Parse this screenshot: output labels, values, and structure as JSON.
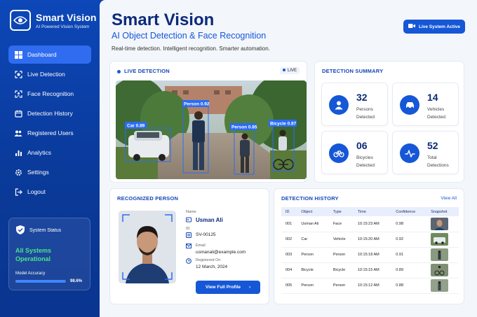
{
  "brand": {
    "name": "Smart Vision",
    "tagline": "AI Powered Vision System"
  },
  "nav": [
    {
      "label": "Dashboard",
      "icon": "dashboard-icon",
      "active": true
    },
    {
      "label": "Live Detection",
      "icon": "camera-scan-icon"
    },
    {
      "label": "Face Recognition",
      "icon": "face-scan-icon"
    },
    {
      "label": "Detection History",
      "icon": "calendar-icon"
    },
    {
      "label": "Registered Users",
      "icon": "users-icon"
    },
    {
      "label": "Analytics",
      "icon": "bar-chart-icon"
    },
    {
      "label": "Settings",
      "icon": "gear-icon"
    },
    {
      "label": "Logout",
      "icon": "logout-icon"
    }
  ],
  "system_status": {
    "title": "System Status",
    "status": "All Systems Operational",
    "accuracy_label": "Model Accuracy",
    "accuracy_value": "98.6%",
    "accuracy_fraction": 0.986
  },
  "header": {
    "title": "Smart Vision",
    "subtitle": "AI Object Detection & Face Recognition",
    "tagline": "Real-time detection. Intelligent recognition. Smarter automation.",
    "live_button": "Live System Active"
  },
  "live": {
    "title": "LIVE DETECTION",
    "badge": "LIVE",
    "boxes": [
      {
        "label": "Car 0.89"
      },
      {
        "label": "Person 0.92"
      },
      {
        "label": "Person 0.85"
      },
      {
        "label": "Bicycle 0.87"
      }
    ]
  },
  "summary": {
    "title": "DETECTION SUMMARY",
    "stats": [
      {
        "value": "32",
        "label": "Persons Detected",
        "icon": "person-icon"
      },
      {
        "value": "14",
        "label": "Vehicles Detected",
        "icon": "car-icon"
      },
      {
        "value": "06",
        "label": "Bicycles Detected",
        "icon": "bicycle-icon"
      },
      {
        "value": "52",
        "label": "Total Detections",
        "icon": "pulse-icon"
      }
    ]
  },
  "person": {
    "title": "RECOGNIZED PERSON",
    "name_label": "Name",
    "name": "Usman Ali",
    "id_label": "ID",
    "id": "SV-00125",
    "email_label": "Email",
    "email": "usmanali@example.com",
    "registered_label": "Registered On",
    "registered": "12 March, 2024",
    "button": "View Full Profile"
  },
  "history": {
    "title": "DETECTION HISTORY",
    "view_all": "View All",
    "columns": [
      "ID",
      "Object",
      "Type",
      "Time",
      "Confidence",
      "Snapshot"
    ],
    "rows": [
      {
        "id": "001",
        "object": "Usman Ali",
        "type": "Face",
        "time": "10:15:23 AM",
        "confidence": "0.98"
      },
      {
        "id": "002",
        "object": "Car",
        "type": "Vehicle",
        "time": "10:15:20 AM",
        "confidence": "0.92"
      },
      {
        "id": "003",
        "object": "Person",
        "type": "Person",
        "time": "10:15:18 AM",
        "confidence": "0.91"
      },
      {
        "id": "004",
        "object": "Bicycle",
        "type": "Bicycle",
        "time": "10:15:15 AM",
        "confidence": "0.89"
      },
      {
        "id": "005",
        "object": "Person",
        "type": "Person",
        "time": "10:15:12 AM",
        "confidence": "0.88"
      }
    ]
  },
  "colors": {
    "primary": "#1557d6",
    "sidebar": "#0d47b8",
    "success": "#4be38a",
    "title": "#0d2a7a"
  }
}
